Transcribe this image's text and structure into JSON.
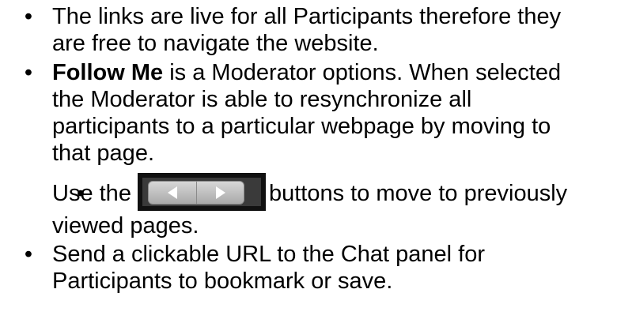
{
  "bullets": [
    {
      "lines": [
        "The links are live for all Participants therefore they",
        "are free to navigate the website."
      ]
    },
    {
      "bold_prefix": "Follow Me",
      "first_line_rest": " is a Moderator options.  When selected",
      "lines": [
        "the Moderator is able to resynchronize all",
        "participants to a particular webpage by moving to",
        "that page."
      ]
    },
    {
      "before_image": "Use the",
      "image_icon": "back-forward-buttons",
      "after_image": "buttons to move to previously",
      "lines": [
        "viewed pages."
      ]
    },
    {
      "lines": [
        "Send a clickable URL to the Chat panel for",
        "Participants to bookmark or save."
      ]
    }
  ],
  "bullet_symbol": "•"
}
